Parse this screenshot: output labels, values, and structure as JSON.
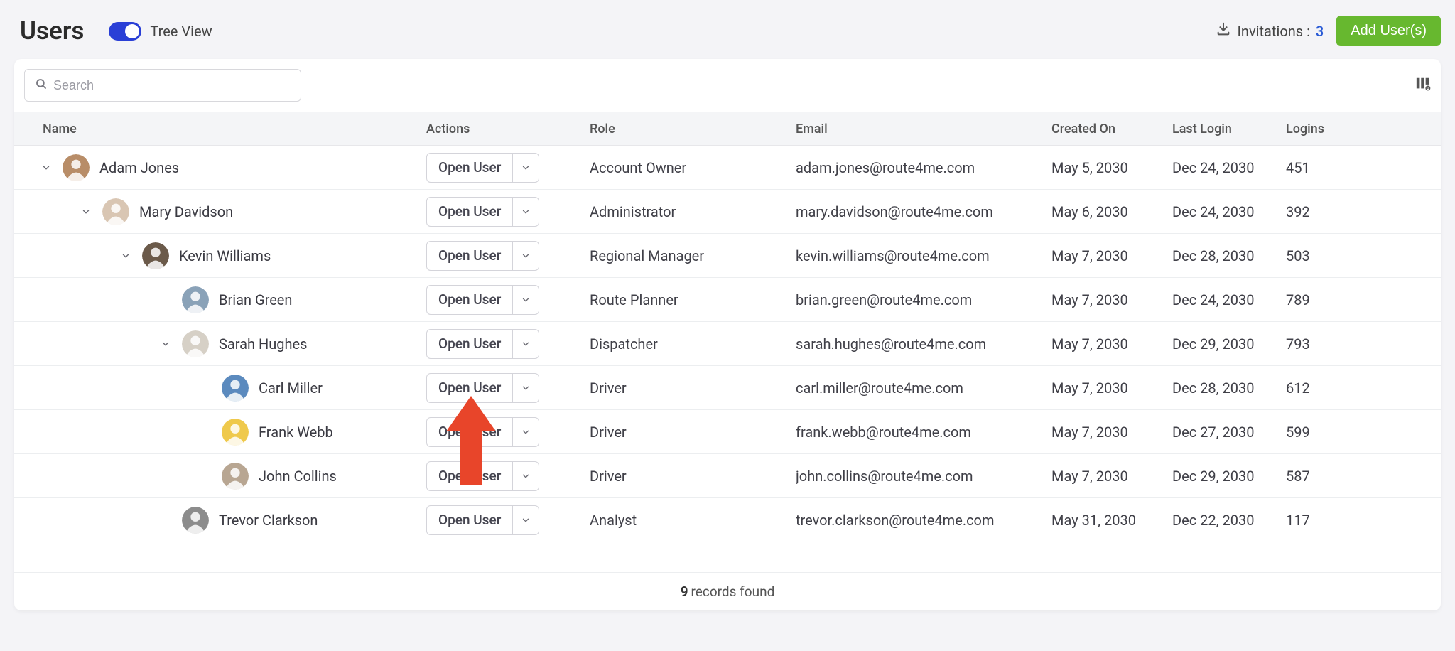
{
  "header": {
    "title": "Users",
    "tree_view_label": "Tree View",
    "invitations_label": "Invitations :",
    "invitations_count": "3",
    "add_user_label": "Add User(s)"
  },
  "search": {
    "placeholder": "Search"
  },
  "columns": {
    "name": "Name",
    "actions": "Actions",
    "role": "Role",
    "email": "Email",
    "created": "Created On",
    "last_login": "Last Login",
    "logins": "Logins"
  },
  "action_button_label": "Open User",
  "rows": [
    {
      "indent": 0,
      "expandable": true,
      "name": "Adam Jones",
      "role": "Account Owner",
      "email": "adam.jones@route4me.com",
      "created": "May 5, 2030",
      "last_login": "Dec 24, 2030",
      "logins": "451",
      "avatar_bg": "#b88d68"
    },
    {
      "indent": 1,
      "expandable": true,
      "name": "Mary Davidson",
      "role": "Administrator",
      "email": "mary.davidson@route4me.com",
      "created": "May 6, 2030",
      "last_login": "Dec 24, 2030",
      "logins": "392",
      "avatar_bg": "#d9c6b3"
    },
    {
      "indent": 2,
      "expandable": true,
      "name": "Kevin Williams",
      "role": "Regional Manager",
      "email": "kevin.williams@route4me.com",
      "created": "May 7, 2030",
      "last_login": "Dec 28, 2030",
      "logins": "503",
      "avatar_bg": "#6b5a4a"
    },
    {
      "indent": 3,
      "expandable": false,
      "name": "Brian Green",
      "role": "Route Planner",
      "email": "brian.green@route4me.com",
      "created": "May 7, 2030",
      "last_login": "Dec 24, 2030",
      "logins": "789",
      "avatar_bg": "#8aa2b8"
    },
    {
      "indent": 3,
      "expandable": true,
      "name": "Sarah Hughes",
      "role": "Dispatcher",
      "email": "sarah.hughes@route4me.com",
      "created": "May 7, 2030",
      "last_login": "Dec 29, 2030",
      "logins": "793",
      "avatar_bg": "#d6d0c6"
    },
    {
      "indent": 4,
      "expandable": false,
      "name": "Carl Miller",
      "role": "Driver",
      "email": "carl.miller@route4me.com",
      "created": "May 7, 2030",
      "last_login": "Dec 28, 2030",
      "logins": "612",
      "avatar_bg": "#5b8abe"
    },
    {
      "indent": 4,
      "expandable": false,
      "name": "Frank Webb",
      "role": "Driver",
      "email": "frank.webb@route4me.com",
      "created": "May 7, 2030",
      "last_login": "Dec 27, 2030",
      "logins": "599",
      "avatar_bg": "#efc94c"
    },
    {
      "indent": 4,
      "expandable": false,
      "name": "John Collins",
      "role": "Driver",
      "email": "john.collins@route4me.com",
      "created": "May 7, 2030",
      "last_login": "Dec 29, 2030",
      "logins": "587",
      "avatar_bg": "#b8a692"
    },
    {
      "indent": 3,
      "expandable": false,
      "name": "Trevor Clarkson",
      "role": "Analyst",
      "email": "trevor.clarkson@route4me.com",
      "created": "May 31, 2030",
      "last_login": "Dec 22, 2030",
      "logins": "117",
      "avatar_bg": "#8c8c8c"
    }
  ],
  "footer": {
    "count": "9",
    "text": "records found"
  },
  "overlay_arrow_color": "#e8452a"
}
